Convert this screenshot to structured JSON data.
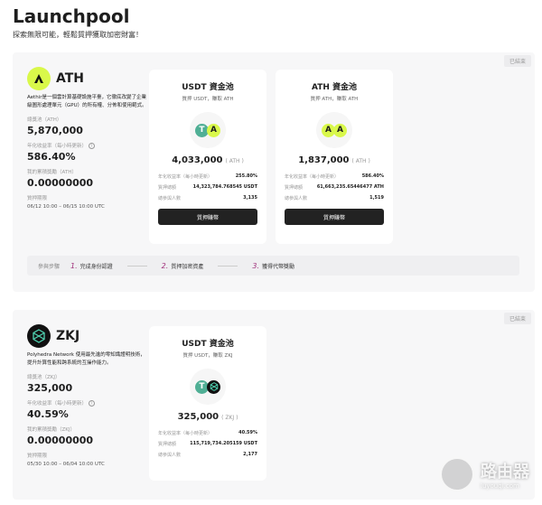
{
  "header": {
    "title": "Launchpool",
    "subtitle": "探索無限可能，輕鬆質押獲取加密財富！"
  },
  "projects": [
    {
      "status": "已結束",
      "token": "ATH",
      "description": "Aethir是一個雲計算基礎設施平臺，它徹底改變了企業級圖形處理單元（GPU）的所有權、分佈和使用範式。",
      "total_pool_label": "總獎池（ATH）",
      "total_pool": "5,870,000",
      "apr_label": "年化收益率（每小時更新）",
      "apr": "586.40%",
      "my_rewards_label": "我的累積獎勵（ATH）",
      "my_rewards": "0.00000000",
      "period_label": "質押期限",
      "period": "06/12 10:00 – 06/15 10:00 UTC",
      "pools": [
        {
          "title": "USDT 資金池",
          "subtitle": "質押 USDT，賺取 ATH",
          "amount": "4,033,000",
          "unit": "( ATH )",
          "apr_label": "年化收益率（每小時更新）",
          "apr": "255.80%",
          "staked_label": "質押總額",
          "staked": "14,323,784.768545 USDT",
          "participants_label": "總參與人數",
          "participants": "3,135",
          "button": "質押賺幣"
        },
        {
          "title": "ATH 資金池",
          "subtitle": "質押 ATH，賺取 ATH",
          "amount": "1,837,000",
          "unit": "( ATH )",
          "apr_label": "年化收益率（每小時更新）",
          "apr": "586.40%",
          "staked_label": "質押總額",
          "staked": "61,663,235.65446477 ATH",
          "participants_label": "總參與人數",
          "participants": "1,519",
          "button": "質押賺幣"
        }
      ],
      "steps": {
        "label": "參與步驟",
        "items": [
          {
            "n": "1.",
            "text": "完成身份認證"
          },
          {
            "n": "2.",
            "text": "質押加密資產"
          },
          {
            "n": "3.",
            "text": "獲得代幣獎勵"
          }
        ]
      }
    },
    {
      "status": "已結束",
      "token": "ZKJ",
      "description": "Polyhedra Network 使用最先進的零知識證明技術，提升計算性能和跨系統的互操作能力。",
      "total_pool_label": "總獎池（ZKJ）",
      "total_pool": "325,000",
      "apr_label": "年化收益率（每小時更新）",
      "apr": "40.59%",
      "my_rewards_label": "我的累積獎勵（ZKJ）",
      "my_rewards": "0.00000000",
      "period_label": "質押期限",
      "period": "05/30 10:00 – 06/04 10:00 UTC",
      "pools": [
        {
          "title": "USDT 資金池",
          "subtitle": "質押 USDT，賺取 ZKJ",
          "amount": "325,000",
          "unit": "( ZKJ )",
          "apr_label": "年化收益率（每小時更新）",
          "apr": "40.59%",
          "staked_label": "質押總額",
          "staked": "115,719,734.205159 USDT",
          "participants_label": "總參與人數",
          "participants": "2,177"
        }
      ]
    }
  ],
  "watermark": {
    "text": "路由器",
    "url": "luyouqi.com"
  },
  "colors": {
    "ath": "#d9f84a",
    "usdt": "#50af95",
    "zkj": "#111111",
    "step": "#a0307a"
  }
}
